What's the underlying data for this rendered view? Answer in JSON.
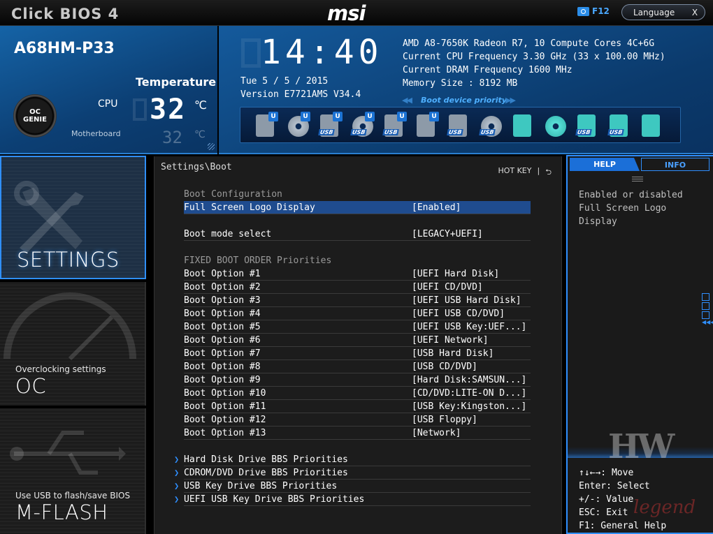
{
  "topbar": {
    "app_title": "Click BIOS 4",
    "brand": "msi",
    "screenshot_key": "F12",
    "language_label": "Language",
    "close_label": "X"
  },
  "header": {
    "board_name": "A68HM-P33",
    "temperature_title": "Temperature",
    "oc_genie_label": "OC GENIE",
    "cpu_label": "CPU",
    "cpu_temp": "32",
    "temp_unit": "℃",
    "motherboard_label": "Motherboard",
    "motherboard_temp": "32",
    "clock": "14:40",
    "date": "Tue  5 / 5 / 2015",
    "version": "Version E7721AMS V34.4",
    "sysinfo": [
      "AMD A8-7650K Radeon R7, 10 Compute Cores 4C+6G",
      "Current CPU Frequency 3.30 GHz (33 x 100.00 MHz)",
      "Current DRAM Frequency 1600 MHz",
      "Memory Size : 8192 MB"
    ],
    "boot_device_priority_label": "Boot device priority",
    "boot_devices": [
      {
        "icon": "hard-disk-icon",
        "badge": "U",
        "usb": ""
      },
      {
        "icon": "optical-disc-icon",
        "badge": "U",
        "usb": ""
      },
      {
        "icon": "usb-hard-disk-icon",
        "badge": "U",
        "usb": "USB"
      },
      {
        "icon": "usb-optical-disc-icon",
        "badge": "U",
        "usb": "USB"
      },
      {
        "icon": "usb-key-icon",
        "badge": "U",
        "usb": "USB"
      },
      {
        "icon": "network-icon",
        "badge": "U",
        "usb": ""
      },
      {
        "icon": "usb-hard-disk-icon",
        "badge": "",
        "usb": "USB"
      },
      {
        "icon": "usb-optical-disc-icon",
        "badge": "",
        "usb": "USB"
      },
      {
        "icon": "hard-disk-icon",
        "badge": "",
        "usb": ""
      },
      {
        "icon": "optical-disc-icon",
        "badge": "",
        "usb": ""
      },
      {
        "icon": "usb-key-icon",
        "badge": "",
        "usb": "USB"
      },
      {
        "icon": "usb-floppy-icon",
        "badge": "",
        "usb": "USB"
      },
      {
        "icon": "network-icon",
        "badge": "",
        "usb": ""
      }
    ]
  },
  "nav": {
    "settings_label": "SETTINGS",
    "oc_sub": "Overclocking settings",
    "oc_label": "OC",
    "mflash_sub": "Use USB to flash/save BIOS",
    "mflash_label": "M-FLASH"
  },
  "main": {
    "breadcrumb": "Settings\\Boot",
    "hotkey_label": "HOT KEY",
    "hotkey_sep": "|",
    "section_boot_config": "Boot Configuration",
    "full_screen_logo_label": "Full Screen Logo Display",
    "full_screen_logo_value": "[Enabled]",
    "boot_mode_label": "Boot mode select",
    "boot_mode_value": "[LEGACY+UEFI]",
    "section_fixed_order": "FIXED BOOT ORDER Priorities",
    "boot_options": [
      {
        "label": "Boot Option #1",
        "value": "[UEFI Hard Disk]"
      },
      {
        "label": "Boot Option #2",
        "value": "[UEFI CD/DVD]"
      },
      {
        "label": "Boot Option #3",
        "value": "[UEFI USB Hard Disk]"
      },
      {
        "label": "Boot Option #4",
        "value": "[UEFI USB CD/DVD]"
      },
      {
        "label": "Boot Option #5",
        "value": "[UEFI USB Key:UEF...]"
      },
      {
        "label": "Boot Option #6",
        "value": "[UEFI Network]"
      },
      {
        "label": "Boot Option #7",
        "value": "[USB Hard Disk]"
      },
      {
        "label": "Boot Option #8",
        "value": "[USB CD/DVD]"
      },
      {
        "label": "Boot Option #9",
        "value": "[Hard Disk:SAMSUN...]"
      },
      {
        "label": "Boot Option #10",
        "value": "[CD/DVD:LITE-ON D...]"
      },
      {
        "label": "Boot Option #11",
        "value": "[USB Key:Kingston...]"
      },
      {
        "label": "Boot Option #12",
        "value": "[USB Floppy]"
      },
      {
        "label": "Boot Option #13",
        "value": "[Network]"
      }
    ],
    "submenus": [
      "Hard Disk Drive BBS Priorities",
      "CDROM/DVD Drive BBS Priorities",
      "USB Key Drive BBS Priorities",
      "UEFI USB Key Drive BBS Priorities"
    ]
  },
  "help": {
    "tab_help": "HELP",
    "tab_info": "INFO",
    "text": [
      "Enabled or disabled",
      "Full Screen Logo",
      "Display"
    ],
    "keys": [
      "↑↓←→: Move",
      "Enter: Select",
      "+/-: Value",
      "ESC: Exit",
      "F1: General Help"
    ]
  },
  "watermark": {
    "top": "HW",
    "bottom": "legend"
  },
  "colors": {
    "accent": "#2f8fff",
    "selection": "#1f4c8f",
    "header_blue": "#0c3f74"
  }
}
